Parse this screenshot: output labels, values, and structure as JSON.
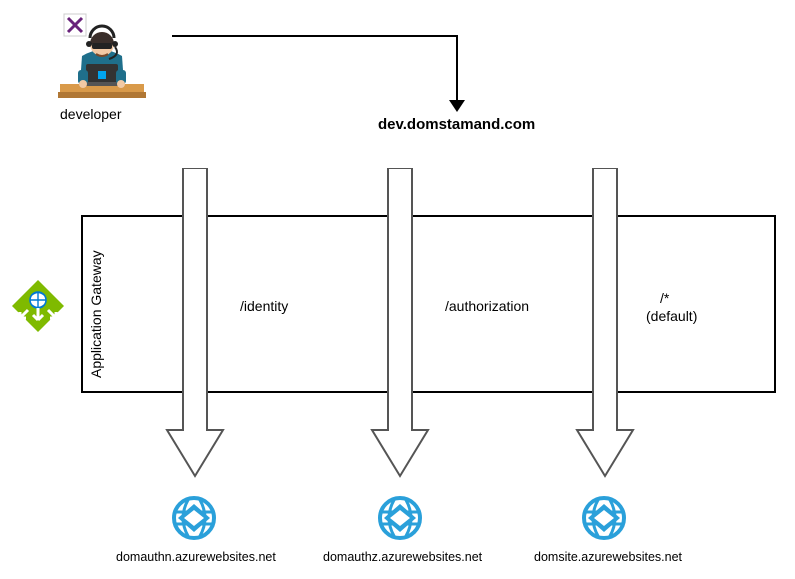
{
  "developer": {
    "label": "developer"
  },
  "domain": {
    "title": "dev.domstamand.com"
  },
  "gateway": {
    "label": "Application Gateway"
  },
  "paths": {
    "p1": "/identity",
    "p2": "/authorization",
    "p3_line1": "/*",
    "p3_line2": "(default)"
  },
  "backends": {
    "b1": "domauthn.azurewebsites.net",
    "b2": "domauthz.azurewebsites.net",
    "b3": "domsite.azurewebsites.net"
  },
  "chart_data": {
    "type": "diagram",
    "title": "Azure Application Gateway path-based routing for dev.domstamand.com",
    "nodes": [
      {
        "id": "developer",
        "label": "developer",
        "type": "actor"
      },
      {
        "id": "domain",
        "label": "dev.domstamand.com",
        "type": "endpoint"
      },
      {
        "id": "gateway",
        "label": "Application Gateway",
        "type": "service"
      },
      {
        "id": "b1",
        "label": "domauthn.azurewebsites.net",
        "type": "app-service"
      },
      {
        "id": "b2",
        "label": "domauthz.azurewebsites.net",
        "type": "app-service"
      },
      {
        "id": "b3",
        "label": "domsite.azurewebsites.net",
        "type": "app-service"
      }
    ],
    "edges": [
      {
        "from": "developer",
        "to": "domain"
      },
      {
        "from": "domain",
        "to": "gateway"
      },
      {
        "from": "gateway",
        "to": "b1",
        "rule": "/identity"
      },
      {
        "from": "gateway",
        "to": "b2",
        "rule": "/authorization"
      },
      {
        "from": "gateway",
        "to": "b3",
        "rule": "/* (default)"
      }
    ]
  }
}
